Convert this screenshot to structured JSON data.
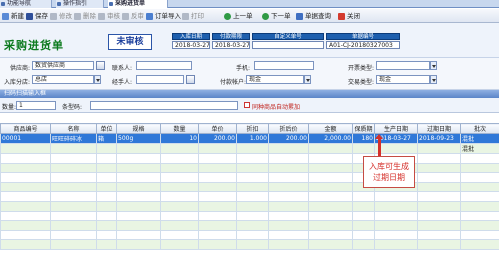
{
  "tabs": [
    "功能导航",
    "操作指引",
    "采购进货单"
  ],
  "toolbar": [
    "新建",
    "保存",
    "修改",
    "删除",
    "审核",
    "反审",
    "订单导入",
    "打印",
    "上一单",
    "下一单",
    "单据查询",
    "关闭"
  ],
  "page_title": "采购进货单",
  "status_badge": "未审核",
  "header_fields": [
    {
      "label": "入库日期",
      "value": "2018-03-27"
    },
    {
      "label": "付款期限",
      "value": "2018-03-27"
    },
    {
      "label": "自定义单号",
      "value": ""
    },
    {
      "label": "单据编号",
      "value": "A01-CJ-20180327003"
    }
  ],
  "form": {
    "supplier_label": "供应商:",
    "supplier_value": "数贸供应商",
    "contact_label": "联系人:",
    "phone_label": "手机:",
    "invoice_type_label": "开票类型:",
    "warehouse_label": "入库分店:",
    "warehouse_value": "总店",
    "handler_label": "经手人:",
    "payment_account_label": "付款帐户:",
    "payment_account_value": "现金",
    "trade_type_label": "交易类型:",
    "trade_type_value": "现金"
  },
  "scan": {
    "bar_title": "扫码扫描输入框",
    "qty_label": "数量:",
    "qty_value": "1",
    "barcode_label": "条型码:",
    "barcode_value": "",
    "merge_label": "同种商品自动累加"
  },
  "table": {
    "columns": [
      "商品编号",
      "名称",
      "单位",
      "规格",
      "数量",
      "单价",
      "折扣",
      "折后价",
      "金额",
      "保质期",
      "生产日期",
      "过期日期",
      "批次"
    ],
    "rows": [
      [
        "00001",
        "旺旺碎碎冰",
        "箱",
        "500g",
        "10",
        "200.00",
        "1.000",
        "200.00",
        "2,000.00",
        "180",
        "2018-03-27",
        "2018-09-23",
        "混批"
      ],
      [
        "",
        "",
        "",
        "",
        "",
        "",
        "",
        "",
        "",
        "",
        "",
        "",
        "混批"
      ],
      [
        "",
        "",
        "",
        "",
        "",
        "",
        "",
        "",
        "",
        "",
        "",
        "",
        ""
      ],
      [
        "",
        "",
        "",
        "",
        "",
        "",
        "",
        "",
        "",
        "",
        "",
        "",
        ""
      ],
      [
        "",
        "",
        "",
        "",
        "",
        "",
        "",
        "",
        "",
        "",
        "",
        "",
        ""
      ],
      [
        "",
        "",
        "",
        "",
        "",
        "",
        "",
        "",
        "",
        "",
        "",
        "",
        ""
      ],
      [
        "",
        "",
        "",
        "",
        "",
        "",
        "",
        "",
        "",
        "",
        "",
        "",
        ""
      ],
      [
        "",
        "",
        "",
        "",
        "",
        "",
        "",
        "",
        "",
        "",
        "",
        "",
        ""
      ],
      [
        "",
        "",
        "",
        "",
        "",
        "",
        "",
        "",
        "",
        "",
        "",
        "",
        ""
      ],
      [
        "",
        "",
        "",
        "",
        "",
        "",
        "",
        "",
        "",
        "",
        "",
        "",
        ""
      ],
      [
        "",
        "",
        "",
        "",
        "",
        "",
        "",
        "",
        "",
        "",
        "",
        "",
        ""
      ],
      [
        "",
        "",
        "",
        "",
        "",
        "",
        "",
        "",
        "",
        "",
        "",
        "",
        ""
      ]
    ]
  },
  "callout": {
    "line1": "入库可生成",
    "line2": "过期日期"
  },
  "colors": {
    "title_green": "#0c7a1e",
    "header_blue": "#1e5fae",
    "selected_row": "#2f78d8",
    "alt_row": "#e9f5e3",
    "callout_red": "#d5302a"
  }
}
